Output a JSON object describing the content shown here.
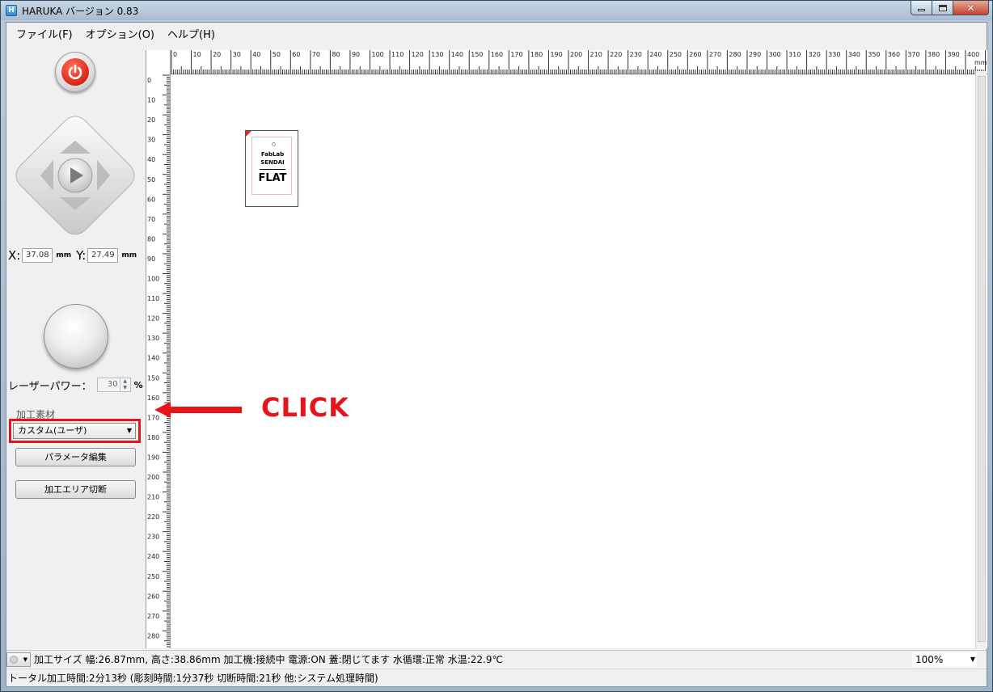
{
  "window": {
    "title": "HARUKA バージョン 0.83",
    "app_icon_text": "H"
  },
  "menu": [
    "ファイル(F)",
    "オプション(O)",
    "ヘルプ(H)"
  ],
  "controls": {
    "x_label": "X:",
    "x_value": "37.08",
    "y_label": "Y:",
    "y_value": "27.49",
    "unit": "mm",
    "laser_power_label": "レーザーパワー：",
    "laser_power_value": "30",
    "laser_power_unit": "%",
    "material_label": "加工素材",
    "material_selected": "カスタム(ユーザ)",
    "edit_params_label": "パラメータ編集",
    "cut_area_label": "加工エリア切断"
  },
  "ruler": {
    "unit": "mm",
    "top_max": 410,
    "left_max": 290,
    "step": 10
  },
  "workpiece": {
    "line1": "FabLab",
    "line2": "SENDAI",
    "line3": "FLAT"
  },
  "annotation": {
    "text": "CLICK",
    "color": "#e8141c"
  },
  "status": {
    "line1": "加工サイズ 幅:26.87mm, 高さ:38.86mm 加工機:接続中 電源:ON 蓋:閉じてます 水循環:正常 水温:22.9℃",
    "zoom": "100%",
    "line2": "トータル加工時間:2分13秒 (彫刻時間:1分37秒 切断時間:21秒 他:システム処理時間)"
  }
}
